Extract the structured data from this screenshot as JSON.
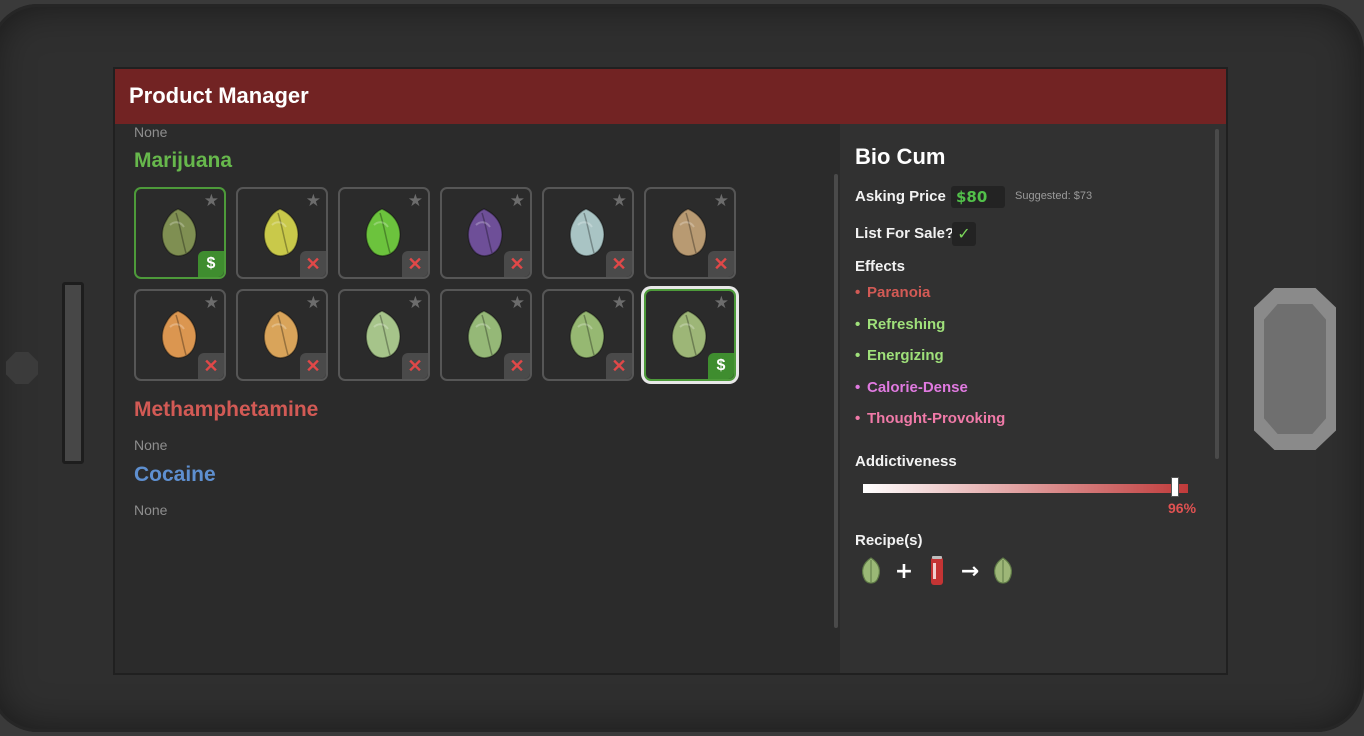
{
  "window": {
    "title": "Product Manager"
  },
  "left": {
    "top_none": "None",
    "categories": [
      {
        "name": "Marijuana",
        "color": "#67b84c"
      },
      {
        "name": "Methamphetamine",
        "color": "#d25a55",
        "empty_text": "None"
      },
      {
        "name": "Cocaine",
        "color": "#5e8fcf",
        "empty_text": "None"
      }
    ],
    "products": [
      {
        "leaf_color": "#7f8f52",
        "listed": true,
        "badge": "$"
      },
      {
        "leaf_color": "#c9c94a",
        "listed": false,
        "badge": "✕"
      },
      {
        "leaf_color": "#6cc33d",
        "listed": false,
        "badge": "✕"
      },
      {
        "leaf_color": "#6e4f98",
        "listed": false,
        "badge": "✕"
      },
      {
        "leaf_color": "#a9c4c4",
        "listed": false,
        "badge": "✕"
      },
      {
        "leaf_color": "#b89a72",
        "listed": false,
        "badge": "✕"
      },
      {
        "leaf_color": "#db9650",
        "listed": false,
        "badge": "✕"
      },
      {
        "leaf_color": "#d9a45a",
        "listed": false,
        "badge": "✕"
      },
      {
        "leaf_color": "#a6c48a",
        "listed": false,
        "badge": "✕"
      },
      {
        "leaf_color": "#95b877",
        "listed": false,
        "badge": "✕"
      },
      {
        "leaf_color": "#96b872",
        "listed": false,
        "badge": "✕"
      },
      {
        "leaf_color": "#9db677",
        "listed": true,
        "badge": "$",
        "selected": true
      }
    ]
  },
  "detail": {
    "product_name": "Bio Cum",
    "asking_price_label": "Asking Price",
    "asking_price": "$80",
    "suggested": "Suggested: $73",
    "list_for_sale_label": "List For Sale?",
    "list_for_sale_check": "✓",
    "effects_label": "Effects",
    "effects": [
      {
        "name": "Paranoia",
        "color": "#d25a55"
      },
      {
        "name": "Refreshing",
        "color": "#9fe07a"
      },
      {
        "name": "Energizing",
        "color": "#9fe07a"
      },
      {
        "name": "Calorie-Dense",
        "color": "#e07ae0"
      },
      {
        "name": "Thought-Provoking",
        "color": "#f07aa8"
      }
    ],
    "addictiveness_label": "Addictiveness",
    "addictiveness_value": 0.96,
    "addictiveness_text": "96%",
    "recipes_label": "Recipe(s)",
    "recipe": {
      "plus": "+",
      "arrow": "→"
    }
  }
}
